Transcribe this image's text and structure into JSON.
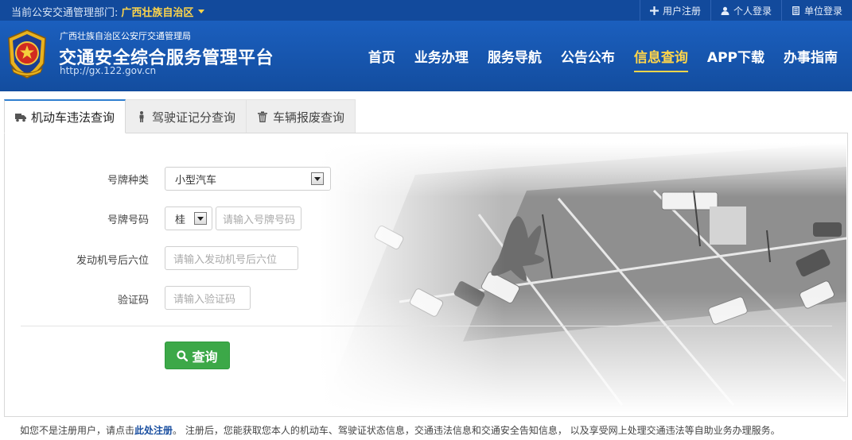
{
  "topbar": {
    "dept_label": "当前公安交通管理部门:",
    "dept_region": "广西壮族自治区",
    "links": [
      {
        "label": "用户注册",
        "icon": "plus-icon"
      },
      {
        "label": "个人登录",
        "icon": "user-icon"
      },
      {
        "label": "单位登录",
        "icon": "building-icon"
      }
    ]
  },
  "header": {
    "org_name": "广西壮族自治区公安厅交通管理局",
    "site_name": "交通安全综合服务管理平台",
    "site_url": "http://gx.122.gov.cn",
    "emblem_icon": "police-emblem-icon",
    "nav": [
      "首页",
      "业务办理",
      "服务导航",
      "公告公布",
      "信息查询",
      "APP下载",
      "办事指南"
    ],
    "active_nav": "信息查询"
  },
  "tabs": [
    {
      "label": "机动车违法查询",
      "icon": "truck-icon",
      "active": true
    },
    {
      "label": "驾驶证记分查询",
      "icon": "person-icon",
      "active": false
    },
    {
      "label": "车辆报废查询",
      "icon": "trash-icon",
      "active": false
    }
  ],
  "form": {
    "plate_type_label": "号牌种类",
    "plate_type_value": "小型汽车",
    "plate_number_label": "号牌号码",
    "plate_prefix_value": "桂",
    "plate_number_placeholder": "请输入号牌号码",
    "engine_label": "发动机号后六位",
    "engine_placeholder": "请输入发动机号后六位",
    "captcha_label": "验证码",
    "captcha_placeholder": "请输入验证码",
    "query_button": "查询"
  },
  "footnote": {
    "prefix": "如您不是注册用户，请点击",
    "link": "此处注册",
    "suffix": "。 注册后，您能获取您本人的机动车、驾驶证状态信息，交通违法信息和交通安全告知信息， 以及享受网上处理交通违法等自助业务办理服务。"
  },
  "colors": {
    "brand_blue": "#1b5fbe",
    "accent_yellow": "#ffd54a",
    "button_green": "#3ca848"
  }
}
